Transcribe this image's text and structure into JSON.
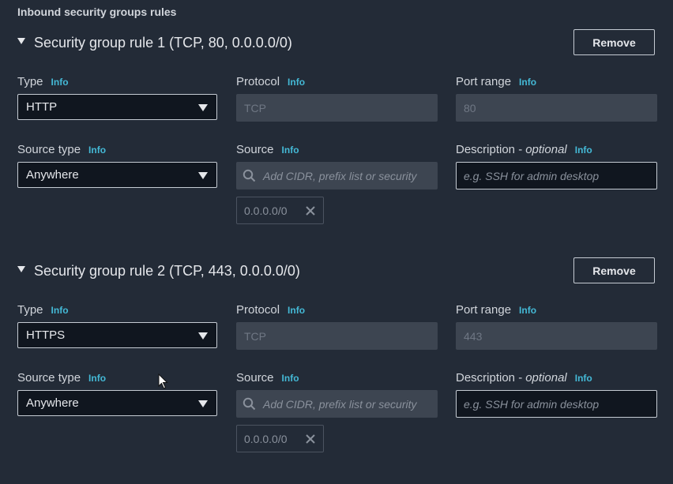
{
  "section_title": "Inbound security groups rules",
  "common": {
    "info": "Info",
    "type_label": "Type",
    "protocol_label": "Protocol",
    "port_range_label": "Port range",
    "source_type_label": "Source type",
    "source_label": "Source",
    "description_label": "Description - ",
    "description_optional": "optional",
    "remove_label": "Remove",
    "source_placeholder": "Add CIDR, prefix list or security",
    "description_placeholder": "e.g. SSH for admin desktop"
  },
  "rules": [
    {
      "title": "Security group rule 1 (TCP, 80, 0.0.0.0/0)",
      "type": "HTTP",
      "protocol": "TCP",
      "port_range": "80",
      "source_type": "Anywhere",
      "source_token": "0.0.0.0/0"
    },
    {
      "title": "Security group rule 2 (TCP, 443, 0.0.0.0/0)",
      "type": "HTTPS",
      "protocol": "TCP",
      "port_range": "443",
      "source_type": "Anywhere",
      "source_token": "0.0.0.0/0"
    }
  ],
  "colors": {
    "background": "#232b37",
    "info_link": "#44b9d6",
    "input_dark": "#10161f",
    "input_disabled": "#3d4551"
  }
}
